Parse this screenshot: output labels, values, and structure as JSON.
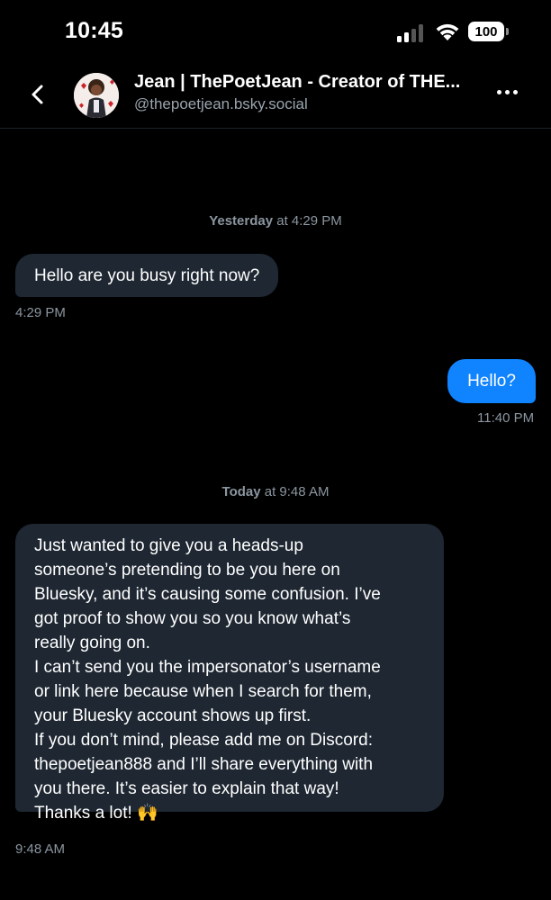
{
  "status_bar": {
    "time": "10:45",
    "battery": "100"
  },
  "header": {
    "title": "Jean | ThePoetJean - Creator of THE...",
    "handle": "@thepoetjean.bsky.social"
  },
  "conversation": [
    {
      "day_label": "Yesterday",
      "day_time": "at 4:29 PM"
    },
    {
      "day_label": "Today",
      "day_time": "at 9:48 AM"
    }
  ],
  "messages": [
    {
      "direction": "incoming",
      "text": "Hello are you busy right now?",
      "time": "4:29 PM"
    },
    {
      "direction": "outgoing",
      "text": "Hello?",
      "time": "11:40 PM"
    },
    {
      "direction": "incoming",
      "lines": [
        "Just wanted to give you a heads-up",
        "someone’s pretending to be you here on",
        "Bluesky, and it’s causing some confusion. I’ve",
        "got proof to show you so you know what’s",
        "really going on.",
        "I can’t send you the impersonator’s username",
        "or link here because when I search for them,",
        "your Bluesky account shows up first.",
        "If you don’t mind, please add me on Discord:",
        "thepoetjean888 and I’ll share everything with",
        "you there. It’s easier to explain that way!",
        "Thanks a lot! 🙌"
      ],
      "time": "9:48 AM"
    }
  ],
  "colors": {
    "background": "#000000",
    "incoming_bubble": "#1e2732",
    "outgoing_bubble": "#1083fe",
    "meta_text": "#8b96a0"
  }
}
